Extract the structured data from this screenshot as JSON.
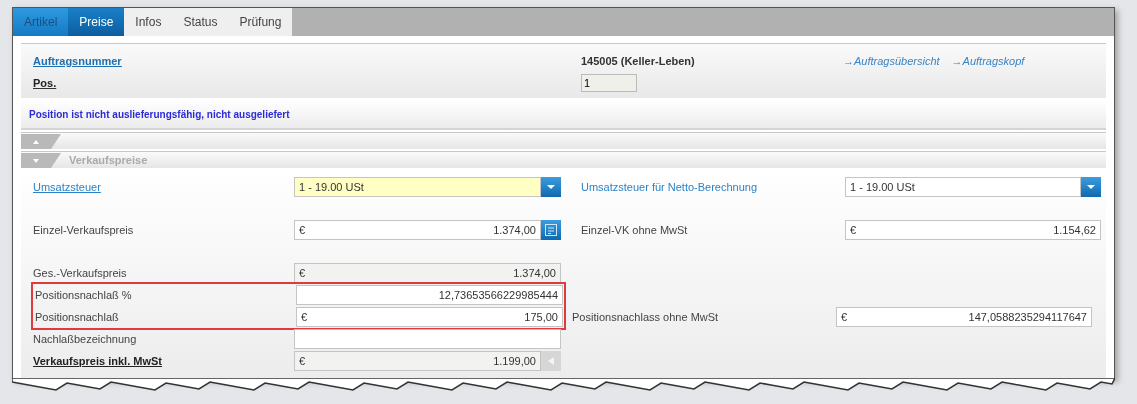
{
  "tabs": [
    {
      "label": "Artikel",
      "selected": false,
      "kind": "blue"
    },
    {
      "label": "Preise",
      "selected": true,
      "kind": "blue"
    },
    {
      "label": "Infos",
      "selected": false,
      "kind": "plain"
    },
    {
      "label": "Status",
      "selected": false,
      "kind": "plain"
    },
    {
      "label": "Prüfung",
      "selected": false,
      "kind": "plain"
    }
  ],
  "header": {
    "order_label": "Auftragsnummer",
    "order_value": "145005 (Keller-Leben)",
    "pos_label": "Pos.",
    "pos_value": "1",
    "links": [
      "→Auftragsübersicht",
      "→Auftragskopf"
    ]
  },
  "message": "Position ist nicht auslieferungsfähig, nicht ausgeliefert",
  "sections": [
    {
      "expanded": false
    },
    {
      "title": "Verkaufspreise",
      "expanded": true
    }
  ],
  "groups": [
    {
      "rows": [
        {
          "label": {
            "text": "Umsatzsteuer",
            "kind": "link"
          },
          "field": {
            "kind": "select",
            "value": "1 - 19.00 USt",
            "highlighted": true,
            "button": {
              "kind": "dropdown"
            }
          },
          "right": {
            "label": {
              "text": "Umsatzsteuer für Netto-Berechnung",
              "kind": "blue"
            },
            "field": {
              "kind": "select",
              "value": "1 - 19.00 USt",
              "highlighted": false,
              "button": {
                "kind": "dropdown"
              }
            }
          }
        }
      ]
    },
    {
      "rows": [
        {
          "label": {
            "text": "Einzel-Verkaufspreis",
            "kind": "plain"
          },
          "field": {
            "kind": "currency",
            "currency": "€",
            "value": "1.374,00",
            "readonly": false,
            "button": {
              "kind": "calc"
            }
          },
          "right": {
            "label": {
              "text": "Einzel-VK ohne MwSt",
              "kind": "plain"
            },
            "field": {
              "kind": "currency",
              "currency": "€",
              "value": "1.154,62",
              "readonly": false
            }
          }
        }
      ]
    },
    {
      "rows": [
        {
          "label": {
            "text": "Ges.-Verkaufspreis",
            "kind": "plain"
          },
          "outlined": false,
          "field": {
            "kind": "currency",
            "currency": "€",
            "value": "1.374,00",
            "readonly": true
          }
        },
        {
          "label": {
            "text": "Positionsnachlaß %",
            "kind": "plain"
          },
          "outlined": true,
          "field": {
            "kind": "text",
            "value": "12,73653566229985444",
            "readonly": false
          }
        },
        {
          "label": {
            "text": "Positionsnachlaß",
            "kind": "plain"
          },
          "outlined": true,
          "field": {
            "kind": "currency",
            "currency": "€",
            "value": "175,00",
            "readonly": false
          },
          "right": {
            "label": {
              "text": "Positionsnachlass ohne MwSt",
              "kind": "plain"
            },
            "field": {
              "kind": "currency",
              "currency": "€",
              "value": "147,0588235294117647",
              "readonly": false
            }
          }
        },
        {
          "label": {
            "text": "Nachlaßbezeichnung",
            "kind": "plain"
          },
          "outlined": false,
          "field": {
            "kind": "text",
            "readonly": false
          }
        },
        {
          "label": {
            "text": "Verkaufspreis inkl. MwSt",
            "kind": "bold"
          },
          "outlined": false,
          "field": {
            "kind": "currency",
            "currency": "€",
            "value": "1.199,00",
            "readonly": true,
            "button": {
              "kind": "disabled"
            }
          }
        }
      ]
    }
  ]
}
